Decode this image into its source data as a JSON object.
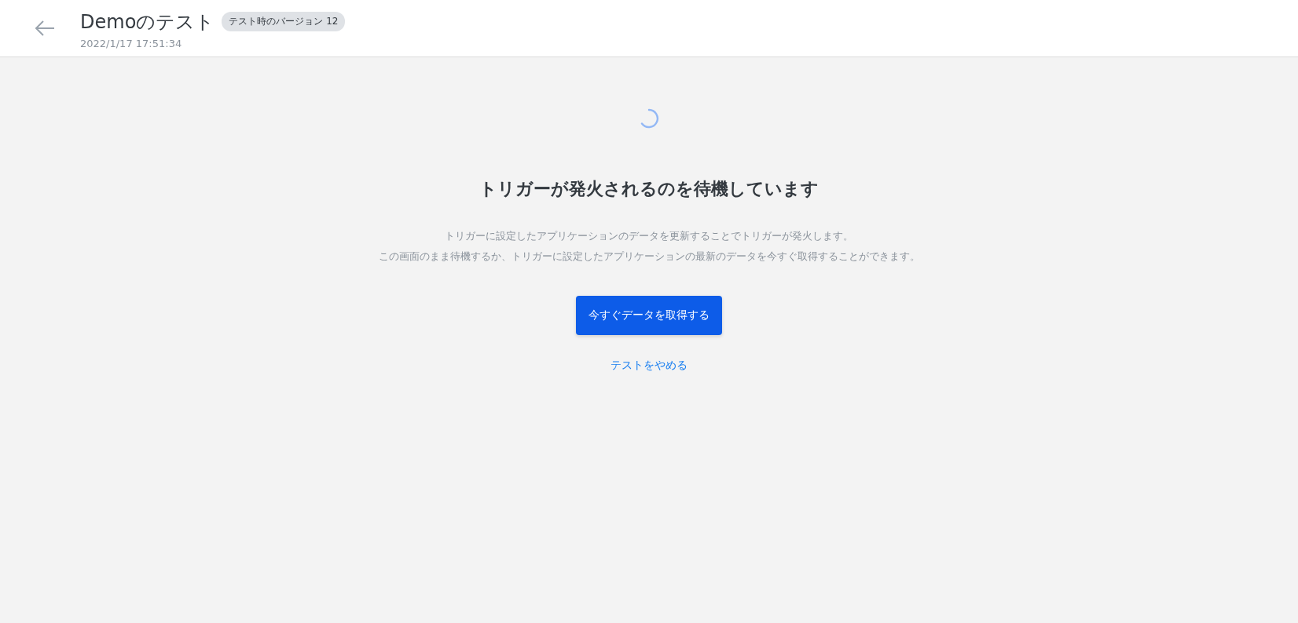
{
  "header": {
    "title": "Demoのテスト",
    "badge": "テスト時のバージョン 12",
    "timestamp": "2022/1/17 17:51:34"
  },
  "waiting": {
    "heading": "トリガーが発火されるのを待機しています",
    "description": [
      "トリガーに設定したアプリケーションのデータを更新することでトリガーが発火します。",
      "この画面のまま待機するか、トリガーに設定したアプリケーションの最新のデータを今すぐ取得することができます。"
    ],
    "primary_button": "今すぐデータを取得する",
    "cancel_link": "テストをやめる"
  }
}
